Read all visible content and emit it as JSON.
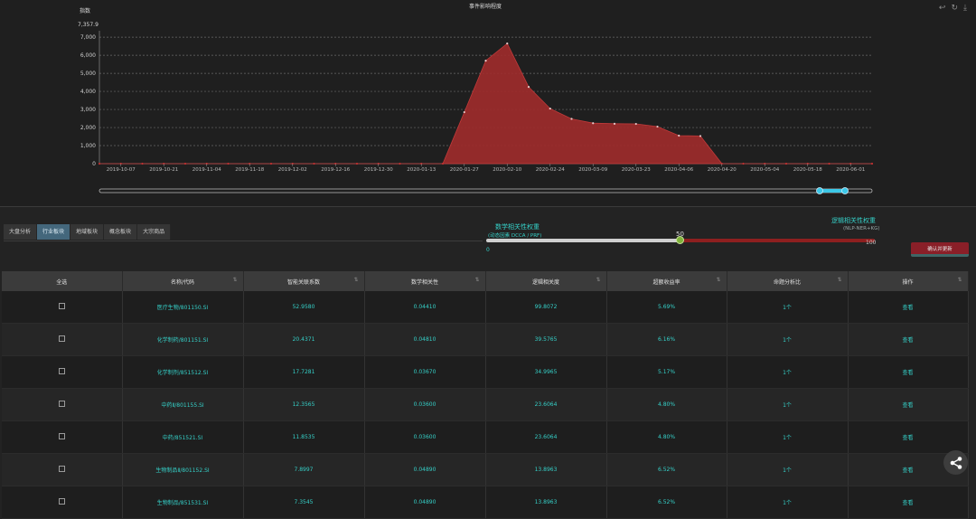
{
  "chart_data": {
    "type": "area",
    "title": "事件影响程度",
    "ylabel": "指数",
    "ymax_label": "7,357.9",
    "y_ticks": [
      "0",
      "1,000",
      "2,000",
      "3,000",
      "4,000",
      "5,000",
      "6,000",
      "7,000"
    ],
    "ylim": [
      0,
      7357.9
    ],
    "x_tick_labels": [
      "2019-10-07",
      "2019-10-21",
      "2019-11-04",
      "2019-11-18",
      "2019-12-02",
      "2019-12-16",
      "2019-12-30",
      "2020-01-13",
      "2020-01-27",
      "2020-02-10",
      "2020-02-24",
      "2020-03-09",
      "2020-03-23",
      "2020-04-06",
      "2020-04-20",
      "2020-05-04",
      "2020-05-18",
      "2020-06-01"
    ],
    "x": [
      "2019-09-30",
      "2019-10-07",
      "2019-10-14",
      "2019-10-21",
      "2019-10-28",
      "2019-11-04",
      "2019-11-11",
      "2019-11-18",
      "2019-11-25",
      "2019-12-02",
      "2019-12-09",
      "2019-12-16",
      "2019-12-23",
      "2019-12-30",
      "2020-01-06",
      "2020-01-13",
      "2020-01-20",
      "2020-01-27",
      "2020-02-03",
      "2020-02-10",
      "2020-02-17",
      "2020-02-24",
      "2020-03-02",
      "2020-03-09",
      "2020-03-16",
      "2020-03-23",
      "2020-03-30",
      "2020-04-06",
      "2020-04-13",
      "2020-04-20",
      "2020-04-27",
      "2020-05-04",
      "2020-05-11",
      "2020-05-18",
      "2020-05-25",
      "2020-06-01",
      "2020-06-08"
    ],
    "values": [
      0,
      0,
      0,
      0,
      0,
      0,
      0,
      0,
      0,
      0,
      0,
      0,
      0,
      0,
      0,
      0,
      0,
      2850,
      5700,
      6650,
      4250,
      3050,
      2480,
      2240,
      2210,
      2200,
      2050,
      1550,
      1530,
      0,
      0,
      0,
      0,
      0,
      0,
      0,
      0
    ],
    "grid": true,
    "color": "#a02b2b"
  },
  "toolbar_icons": [
    "restore-icon",
    "refresh-icon",
    "download-icon"
  ],
  "tabs": [
    "大盘分析",
    "行业板块",
    "地域板块",
    "概念板块",
    "大宗商品"
  ],
  "weights": {
    "left_title": "数学相关性权重",
    "left_sub": "(动态因素 DCCA / PRF)",
    "right_title": "逻辑相关性权重",
    "right_sub": "(NLP-NER+KG)",
    "min": "0",
    "max": "100",
    "value": "50",
    "value_fraction": 0.5,
    "accent": "#35d0c8"
  },
  "confirm_button": "确认并更新",
  "table": {
    "headers": [
      "全选",
      "名称/代码",
      "智能关联系数",
      "数学相关性",
      "逻辑相关度",
      "超额收益率",
      "命题分析比",
      "操作"
    ],
    "rows": [
      {
        "name": "医疗生物/801150.SI",
        "coef": "52.9580",
        "math": "0.04410",
        "logic": "99.8072",
        "excess": "5.69%",
        "ratio": "1个",
        "op": "查看"
      },
      {
        "name": "化学制药/801151.SI",
        "coef": "20.4371",
        "math": "0.04810",
        "logic": "39.5765",
        "excess": "6.16%",
        "ratio": "1个",
        "op": "查看"
      },
      {
        "name": "化学制剂/851512.SI",
        "coef": "17.7281",
        "math": "0.03670",
        "logic": "34.9965",
        "excess": "5.17%",
        "ratio": "1个",
        "op": "查看"
      },
      {
        "name": "中药Ⅱ/801155.SI",
        "coef": "12.3565",
        "math": "0.03600",
        "logic": "23.6064",
        "excess": "4.80%",
        "ratio": "1个",
        "op": "查看"
      },
      {
        "name": "中药/851521.SI",
        "coef": "11.8535",
        "math": "0.03600",
        "logic": "23.6064",
        "excess": "4.80%",
        "ratio": "1个",
        "op": "查看"
      },
      {
        "name": "生物制品Ⅱ/801152.SI",
        "coef": "7.8997",
        "math": "0.04890",
        "logic": "13.8963",
        "excess": "6.52%",
        "ratio": "1个",
        "op": "查看"
      },
      {
        "name": "生物制品/851531.SI",
        "coef": "7.3545",
        "math": "0.04890",
        "logic": "13.8963",
        "excess": "6.52%",
        "ratio": "1个",
        "op": "查看"
      }
    ]
  },
  "share_icon": "share-icon"
}
